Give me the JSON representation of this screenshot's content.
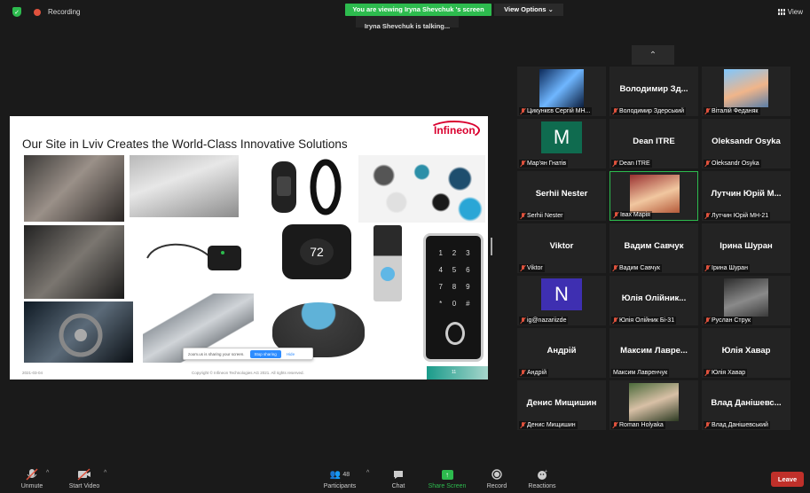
{
  "topbar": {
    "recording_label": "Recording",
    "viewing_banner": "You are viewing Iryna Shevchuk 's screen",
    "view_options": "View Options ⌄",
    "talking": "Iryna Shevchuk  is talking...",
    "view_label": "View"
  },
  "slide": {
    "title": "Our Site in Lviv Creates the World-Class Innovative Solutions",
    "logo": "Infineon",
    "date": "2021-03-04",
    "copyright": "Copyright © Infineon Technologies AG 2021. All rights reserved.",
    "page": "11",
    "share_bar_text": "zoom.us is sharing your screen.",
    "stop_sharing": "Stop sharing",
    "hide": "Hide",
    "thermostat_value": "72"
  },
  "gallery": {
    "tiles": [
      {
        "big": "",
        "label": "Цикункєв Сергій МН..."
      },
      {
        "big": "Володимир Зд...",
        "label": "Володимир Здерський"
      },
      {
        "big": "",
        "label": "Віталій Феданяк"
      },
      {
        "big": "",
        "letter": "M",
        "label": "Мар'ян Гнатів"
      },
      {
        "big": "Dean ITRE",
        "label": "Dean ITRE"
      },
      {
        "big": "Oleksandr Osyka",
        "label": "Oleksandr Osyka"
      },
      {
        "big": "Serhii Nester",
        "label": "Serhii Nester"
      },
      {
        "big": "",
        "label": "Івах Марія"
      },
      {
        "big": "Лутчин Юрій М...",
        "label": "Лутчин Юрій МН-21"
      },
      {
        "big": "Viktor",
        "label": "Viktor"
      },
      {
        "big": "Вадим Савчук",
        "label": "Вадим Савчук"
      },
      {
        "big": "Ірина Шуран",
        "label": "Ірина Шуран"
      },
      {
        "big": "",
        "letter": "N",
        "label": "ig@nazariizde"
      },
      {
        "big": "Юлія Олійник...",
        "label": "Юлія Олійник Бі-31"
      },
      {
        "big": "",
        "label": "Руслан Струк"
      },
      {
        "big": "Андрій",
        "label": "Андрій"
      },
      {
        "big": "Максим  Лавре...",
        "label": "Максим Лавренчук"
      },
      {
        "big": "Юлія Хавар",
        "label": "Юлія Хавар"
      },
      {
        "big": "Денис Мищишин",
        "label": "Денис Мищишин"
      },
      {
        "big": "",
        "label": "Roman Holyaka"
      },
      {
        "big": "Влад Данішевс...",
        "label": "Влад Данішевський"
      }
    ]
  },
  "toolbar": {
    "unmute": "Unmute",
    "start_video": "Start Video",
    "participants": "Participants",
    "participants_count": "48",
    "chat": "Chat",
    "share_screen": "Share Screen",
    "record": "Record",
    "reactions": "Reactions",
    "leave": "Leave"
  }
}
